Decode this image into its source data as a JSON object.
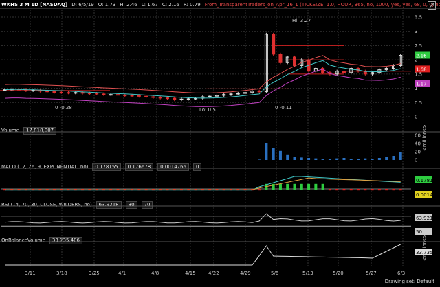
{
  "header": {
    "symbol": "WKHS 3 M 1D [NASDAQ]",
    "date": "D: 6/5/19",
    "open": "O: 1.73",
    "high": "H: 2.46",
    "low": "L: 1.67",
    "close": "C: 2.16",
    "range": "R: 0.79",
    "study": "From_TransparentTraders_on_Apr_16_1 (TICKSIZE, 1.0, HOUR, 365, no, 1000, yes, yes, 68, 0, 0, no, ..."
  },
  "price_panel": {
    "y_ticks": [
      "3.5",
      "3",
      "2.5",
      "2",
      "1.5",
      "1",
      "0.5",
      "0"
    ],
    "hi_label": "Hi: 3.27",
    "lo_label": "Lo: 0.5",
    "price_tags": [
      {
        "value": "2.16",
        "color": "#2ecc40"
      },
      {
        "value": "1.68",
        "color": "#e02020"
      },
      {
        "value": "1.17",
        "color": "#c040c0"
      }
    ],
    "small_labels": [
      "0 -0.28",
      "0 -0.11"
    ]
  },
  "volume_panel": {
    "title": "Volume",
    "value": "17,818,007",
    "y_ticks": [
      "60",
      "40",
      "20",
      "0"
    ],
    "unit": "<millions>"
  },
  "macd_panel": {
    "title": "MACD (12, 26, 9, EXPONENTIAL, no)",
    "v1": "0.178155",
    "v2": "0.176678",
    "v3": "0.0014766",
    "v4": "0",
    "tags": [
      {
        "value": "0.17816",
        "color": "#2ecc40"
      },
      {
        "value": "0.00148",
        "color": "#e0d020"
      }
    ]
  },
  "rsi_panel": {
    "title": "RSI (14, 70, 30, CLOSE, WILDERS, no)",
    "v1": "63.9218",
    "v2": "30",
    "v3": "70",
    "tags": [
      {
        "value": "63.9218",
        "color": "#cccccc"
      },
      {
        "value": "50",
        "color": "#cccccc"
      }
    ]
  },
  "obv_panel": {
    "title": "OnBalanceVolume",
    "value": "33,735,406",
    "tag": "33.7354",
    "unit": "<millions>"
  },
  "x_axis": [
    "3/11",
    "3/18",
    "3/25",
    "4/1",
    "4/8",
    "4/15",
    "4/22",
    "4/29",
    "5/6",
    "5/13",
    "5/20",
    "5/27",
    "6/3"
  ],
  "footer": {
    "drawing_set": "Drawing set: Default"
  }
}
